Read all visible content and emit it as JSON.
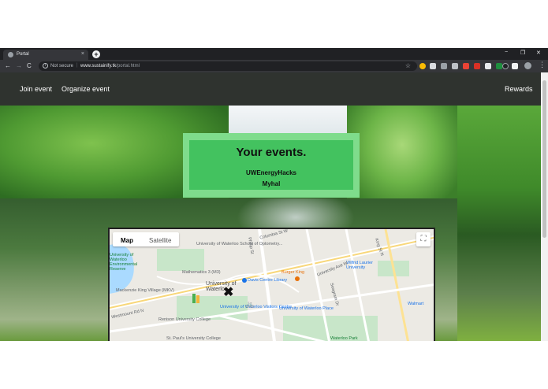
{
  "browser": {
    "tab_title": "Portal",
    "tab_close": "×",
    "new_tab": "+",
    "window_controls": [
      "−",
      "❐",
      "✕"
    ],
    "nav": {
      "back": "←",
      "forward": "→",
      "reload": "C"
    },
    "address": {
      "security_label": "Not secure",
      "separator": "|",
      "host": "www.sustainify.tk",
      "path": "/portal.html",
      "info_icon": "i",
      "star": "☆"
    },
    "kebab": "⋮"
  },
  "site": {
    "nav_left": [
      "Join event",
      "Organize event"
    ],
    "nav_right": "Rewards"
  },
  "events": {
    "title": "Your events.",
    "items": [
      "UWEnergyHacks",
      "Myhal"
    ]
  },
  "map": {
    "types": [
      "Map",
      "Satellite"
    ],
    "active_type": "Map",
    "fullscreen_icon": "⛶",
    "labels": [
      "University of Waterloo School of Optometry...",
      "Mathematics 3 (M3)",
      "Davis Centre Library",
      "Burger King",
      "University of Waterloo Environmental Reserve",
      "Mackenzie King Village (MKV)",
      "Renison University College",
      "St. Paul's University College",
      "University of Waterloo Visitors Centre",
      "University of Waterloo Place",
      "Wilfrid Laurier University",
      "Waterloo Park",
      "Walmart",
      "University Ave W",
      "Phillip St",
      "King St N",
      "Columbia St W",
      "Seagram Dr",
      "Westmount Rd N"
    ],
    "campus_label": "University of Waterloo"
  },
  "colors": {
    "card_outer": "#7fdc8c",
    "card_inner": "#43c25f",
    "nav_bg": "#2f332f"
  }
}
